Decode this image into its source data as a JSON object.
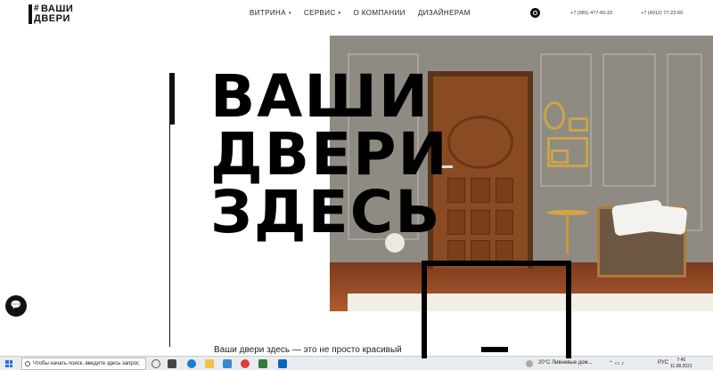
{
  "logo": {
    "hash": "#",
    "line1": "ВАШИ",
    "line2": "ДВЕРИ"
  },
  "nav": {
    "items": [
      {
        "label": "ВИТРИНА",
        "caret": "▾"
      },
      {
        "label": "СЕРВИС",
        "caret": "▾"
      },
      {
        "label": "О КОМПАНИИ",
        "caret": ""
      },
      {
        "label": "ДИЗАЙНЕРАМ",
        "caret": ""
      }
    ]
  },
  "contacts": {
    "phone1": "+7 (981) 477-60-22",
    "phone2": "+7 (4012) 77-22-60"
  },
  "hero": {
    "headline": [
      "ВАШИ",
      "ДВЕРИ",
      "ЗДЕСЬ"
    ],
    "intro": "Ваши двери здесь — это не просто красивый"
  },
  "chat": {
    "icon": "chat-icon",
    "glyph": "💬"
  },
  "taskbar": {
    "search_placeholder": "Чтобы начать поиск, введите здесь запрос",
    "weather": "20°C  Ливневые дож...",
    "lang": "РУС",
    "time": "7:45",
    "date": "11.08.2021"
  },
  "colors": {
    "accent": "#000000",
    "background": "#ffffff",
    "taskbar": "#e9ecef"
  }
}
